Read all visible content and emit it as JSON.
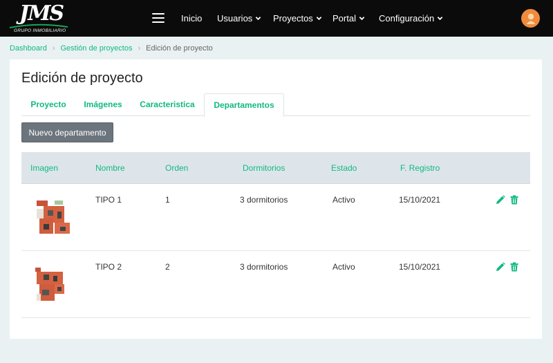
{
  "brand": {
    "logo_text": "JMS",
    "logo_subtitle": "GRUPO INMOBILIARIO"
  },
  "nav": {
    "items": [
      {
        "label": "Inicio",
        "has_dropdown": false
      },
      {
        "label": "Usuarios",
        "has_dropdown": true
      },
      {
        "label": "Proyectos",
        "has_dropdown": true
      },
      {
        "label": "Portal",
        "has_dropdown": true
      },
      {
        "label": "Configuración",
        "has_dropdown": true
      }
    ]
  },
  "breadcrumb": {
    "items": [
      "Dashboard",
      "Gestión de proyectos",
      "Edición de proyecto"
    ]
  },
  "page": {
    "title": "Edición de proyecto"
  },
  "tabs": [
    {
      "label": "Proyecto",
      "active": false
    },
    {
      "label": "Imágenes",
      "active": false
    },
    {
      "label": "Caracteristica",
      "active": false
    },
    {
      "label": "Departamentos",
      "active": true
    }
  ],
  "actions": {
    "new_label": "Nuevo departamento"
  },
  "table": {
    "headers": [
      "Imagen",
      "Nombre",
      "Orden",
      "Dormitorios",
      "Estado",
      "F. Registro"
    ],
    "rows": [
      {
        "nombre": "TIPO 1",
        "orden": "1",
        "dormitorios": "3 dormitorios",
        "estado": "Activo",
        "registro": "15/10/2021"
      },
      {
        "nombre": "TIPO 2",
        "orden": "2",
        "dormitorios": "3 dormitorios",
        "estado": "Activo",
        "registro": "15/10/2021"
      }
    ]
  },
  "colors": {
    "accent": "#10b981",
    "navbar": "#0b0b0b",
    "avatar": "#f08a3c",
    "background": "#e9f1f3"
  },
  "icons": {
    "menu": "hamburger-icon",
    "dropdown": "chevron-down-icon",
    "user": "user-avatar-icon",
    "edit": "pencil-icon",
    "delete": "trash-icon"
  }
}
